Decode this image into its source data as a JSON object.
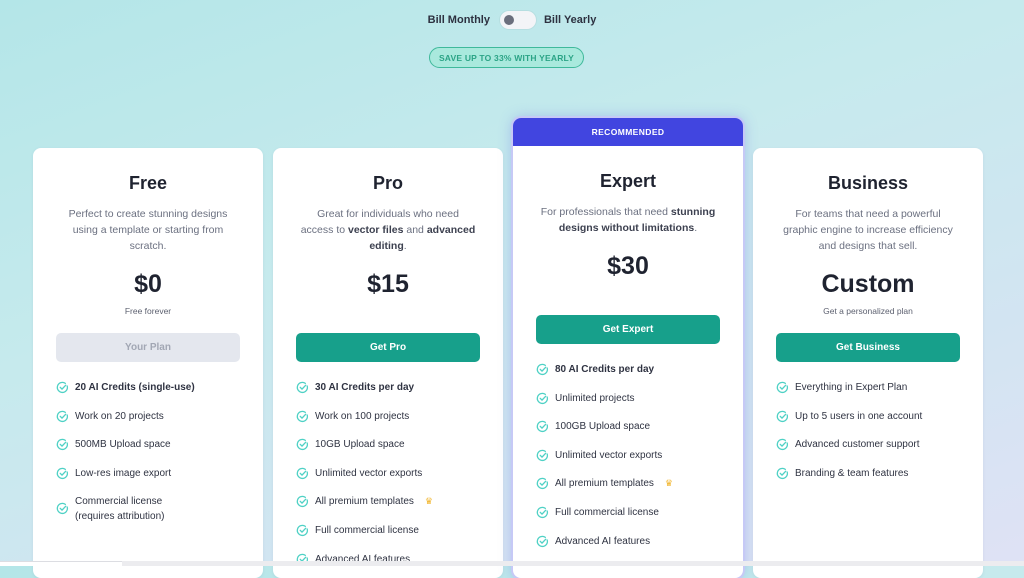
{
  "billing": {
    "monthly_label": "Bill Monthly",
    "yearly_label": "Bill Yearly",
    "toggle_state": "monthly",
    "save_badge": "SAVE UP TO 33% WITH YEARLY"
  },
  "colors": {
    "accent_green": "#17a08b",
    "recommended_blue": "#4145e0",
    "check_teal": "#4fd1c5",
    "crown_gold": "#f1b42a"
  },
  "plans": [
    {
      "name": "Free",
      "description": "Perfect to create stunning designs using a template or starting from scratch.",
      "price": "$0",
      "price_note": "Free forever",
      "cta": "Your Plan",
      "cta_disabled": true,
      "features": [
        {
          "text": "20 AI Credits (single-use)",
          "bold": true
        },
        {
          "text": "Work on 20 projects"
        },
        {
          "text": "500MB Upload space"
        },
        {
          "text": "Low-res image export"
        },
        {
          "text": "Commercial license (requires attribution)"
        }
      ]
    },
    {
      "name": "Pro",
      "description_parts": [
        "Great for individuals who need access to ",
        "vector files",
        " and ",
        "advanced editing",
        "."
      ],
      "price": "$15",
      "price_note": "",
      "cta": "Get Pro",
      "features": [
        {
          "text": "30 AI Credits per day",
          "bold": true
        },
        {
          "text": "Work on 100 projects"
        },
        {
          "text": "10GB Upload space"
        },
        {
          "text": "Unlimited vector exports"
        },
        {
          "text": "All premium templates",
          "icon": "crown-icon"
        },
        {
          "text": "Full commercial license"
        },
        {
          "text": "Advanced AI features"
        }
      ]
    },
    {
      "name": "Expert",
      "badge": "RECOMMENDED",
      "description_parts": [
        "For professionals that need ",
        "stunning designs without limitations",
        "."
      ],
      "price": "$30",
      "price_note": "",
      "cta": "Get Expert",
      "features": [
        {
          "text": "80 AI Credits per day",
          "bold": true
        },
        {
          "text": "Unlimited projects"
        },
        {
          "text": "100GB Upload space"
        },
        {
          "text": "Unlimited vector exports"
        },
        {
          "text": "All premium templates",
          "icon": "crown-icon"
        },
        {
          "text": "Full commercial license"
        },
        {
          "text": "Advanced AI features"
        }
      ]
    },
    {
      "name": "Business",
      "description": "For teams that need a powerful graphic engine to increase efficiency and designs that sell.",
      "price": "Custom",
      "price_note": "Get a personalized plan",
      "cta": "Get Business",
      "features": [
        {
          "text": "Everything in Expert Plan"
        },
        {
          "text": "Up to 5 users in one account"
        },
        {
          "text": "Advanced customer support"
        },
        {
          "text": "Branding & team features"
        }
      ]
    }
  ]
}
